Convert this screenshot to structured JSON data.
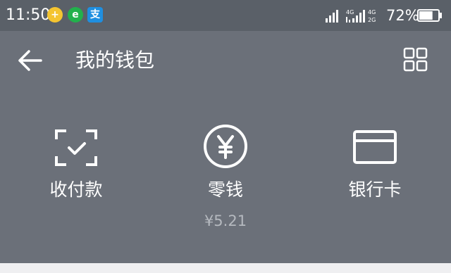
{
  "status_bar": {
    "time": "11:50",
    "notifications": [
      {
        "icon": "plus-app-icon",
        "glyph": "+"
      },
      {
        "icon": "e-app-icon",
        "glyph": "e"
      },
      {
        "icon": "alipay-icon",
        "glyph": "支"
      }
    ],
    "network_1": "4G",
    "network_2_top": "4G",
    "network_2_bottom": "2G",
    "battery_percent": "72%",
    "battery_level": 0.72
  },
  "app_bar": {
    "back_icon": "arrow-left-icon",
    "title": "我的钱包",
    "grid_icon": "grid-icon"
  },
  "wallet": {
    "items": [
      {
        "label": "收付款",
        "icon": "scan-pay-icon"
      },
      {
        "label": "零钱",
        "icon": "yuan-coin-icon",
        "amount": "¥5.21"
      },
      {
        "label": "银行卡",
        "icon": "bank-card-icon"
      }
    ]
  },
  "colors": {
    "status_bar_bg": "#5a6068",
    "panel_bg": "#6b7079",
    "subtext": "#b5b9bf",
    "page_bg": "#efeff1"
  }
}
